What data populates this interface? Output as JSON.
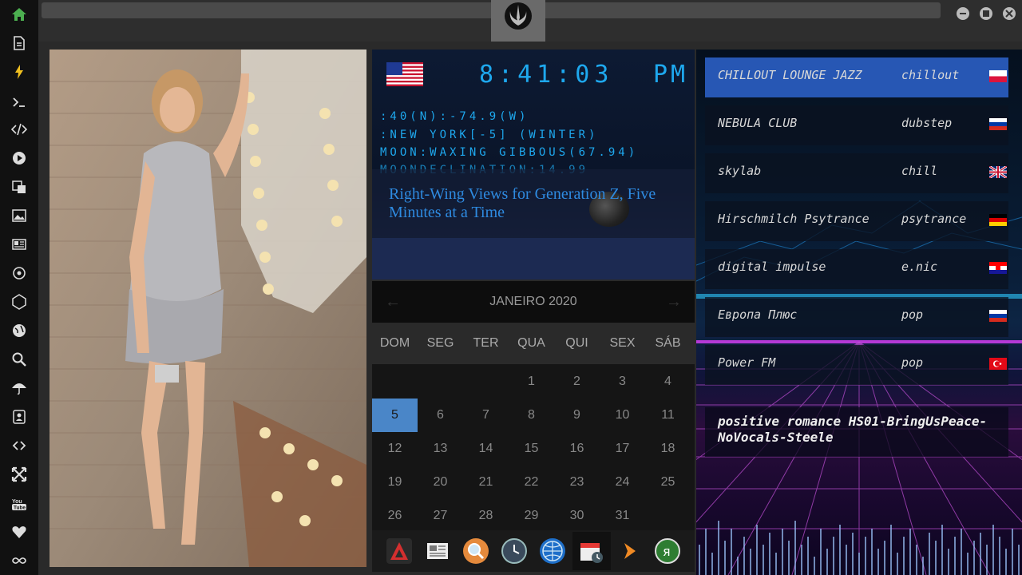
{
  "sidebar": {
    "items": [
      {
        "icon": "home-icon"
      },
      {
        "icon": "document-icon"
      },
      {
        "icon": "lightning-icon"
      },
      {
        "icon": "terminal-icon"
      },
      {
        "icon": "code-icon"
      },
      {
        "icon": "play-icon"
      },
      {
        "icon": "translate-icon"
      },
      {
        "icon": "image-icon"
      },
      {
        "icon": "news-icon"
      },
      {
        "icon": "sun-gear-icon"
      },
      {
        "icon": "hexagon-icon"
      },
      {
        "icon": "globe-icon"
      },
      {
        "icon": "search-icon"
      },
      {
        "icon": "umbrella-icon"
      },
      {
        "icon": "contact-icon"
      },
      {
        "icon": "link-icon"
      },
      {
        "icon": "expand-icon"
      },
      {
        "icon": "youtube-icon"
      },
      {
        "icon": "heart-icon"
      },
      {
        "icon": "infinity-icon"
      }
    ]
  },
  "clock": {
    "time": "8:41:03",
    "ampm": "PM",
    "coords": ":40(N):-74.9(W)",
    "location": ":NEW YORK[-5] (WINTER)",
    "moon": "MOON:WAXING GIBBOUS(67.94)",
    "declination": "MOONDECLINATION:14.99",
    "headline": "Right-Wing Views for Generation Z, Five Minutes at a Time"
  },
  "calendar": {
    "month": "JANEIRO 2020",
    "weekdays": [
      "DOM",
      "SEG",
      "TER",
      "QUA",
      "QUI",
      "SEX",
      "SÁB"
    ],
    "selected_day": "5",
    "weeks": [
      [
        "",
        "",
        "",
        "1",
        "2",
        "3",
        "4"
      ],
      [
        "5",
        "6",
        "7",
        "8",
        "9",
        "10",
        "11"
      ],
      [
        "12",
        "13",
        "14",
        "15",
        "16",
        "17",
        "18"
      ],
      [
        "19",
        "20",
        "21",
        "22",
        "23",
        "24",
        "25"
      ],
      [
        "26",
        "27",
        "28",
        "29",
        "30",
        "31",
        ""
      ]
    ]
  },
  "dock": [
    "app-icon",
    "newspaper-icon",
    "magnifier-icon",
    "clock-icon",
    "globe-icon",
    "calendar-icon",
    "play-arrow-icon",
    "yandex-icon"
  ],
  "radio": {
    "stations": [
      {
        "name": "CHILLOUT LOUNGE JAZZ",
        "genre": "chillout",
        "flag": "poland"
      },
      {
        "name": "NEBULA CLUB",
        "genre": "dubstep",
        "flag": "russia"
      },
      {
        "name": "skylab",
        "genre": "chill",
        "flag": "uk"
      },
      {
        "name": "Hirschmilch Psytrance",
        "genre": "psytrance",
        "flag": "germany"
      },
      {
        "name": "digital impulse",
        "genre": "e.nic",
        "flag": "croatia"
      },
      {
        "name": "Европа Плюс",
        "genre": "pop",
        "flag": "russia"
      },
      {
        "name": "Power FM",
        "genre": "pop",
        "flag": "turkey"
      }
    ],
    "now_playing": "positive romance HS01-BringUsPeace-NoVocals-Steele"
  },
  "colors": {
    "accent": "#2757b4",
    "clock": "#1ea8ee",
    "selected_day": "#4a86c8"
  }
}
